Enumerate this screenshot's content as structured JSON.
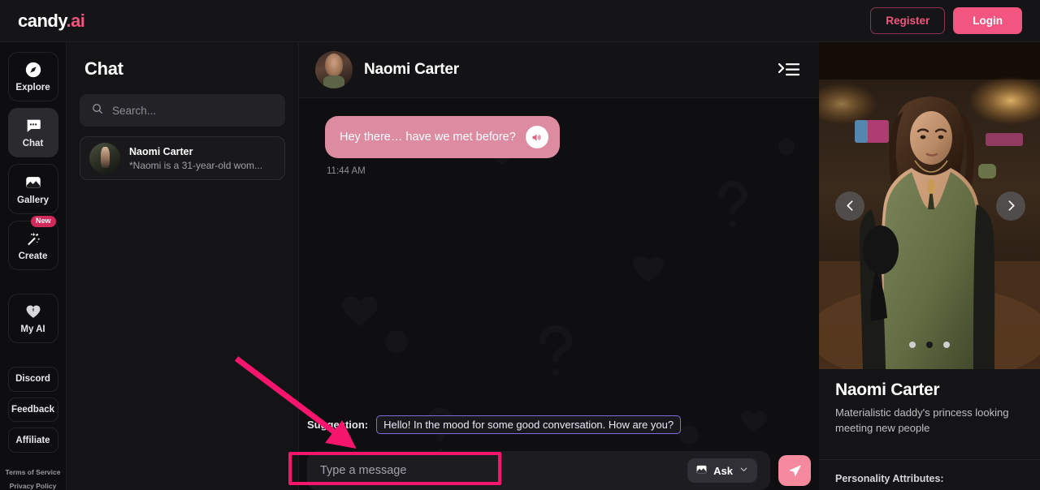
{
  "topbar": {
    "logo_main": "candy",
    "logo_accent": ".ai",
    "register_label": "Register",
    "login_label": "Login",
    "accent_color": "#f2557f"
  },
  "sidebar": {
    "items": [
      {
        "label": "Explore",
        "icon": "compass-icon",
        "active": false
      },
      {
        "label": "Chat",
        "icon": "chat-bubble-icon",
        "active": true
      },
      {
        "label": "Gallery",
        "icon": "image-icon",
        "active": false
      },
      {
        "label": "Create",
        "icon": "magic-wand-icon",
        "active": false,
        "badge": "New"
      },
      {
        "label": "My AI",
        "icon": "heart-icon",
        "active": false
      }
    ],
    "links": [
      {
        "label": "Discord"
      },
      {
        "label": "Feedback"
      },
      {
        "label": "Affiliate"
      }
    ],
    "legal": [
      {
        "label": "Terms of Service"
      },
      {
        "label": "Privacy Policy"
      }
    ]
  },
  "chatlist": {
    "title": "Chat",
    "search_placeholder": "Search...",
    "conversations": [
      {
        "name": "Naomi Carter",
        "snippet": "*Naomi is a 31-year-old wom..."
      }
    ]
  },
  "chat": {
    "header_name": "Naomi Carter",
    "messages": [
      {
        "text": "Hey there… have we met before?",
        "time": "11:44 AM",
        "from": "character"
      }
    ]
  },
  "composer": {
    "suggestion_label": "Suggestion:",
    "suggestion_text": "Hello! In the mood for some good conversation. How are you?",
    "input_placeholder": "Type a message",
    "ask_label": "Ask",
    "send_icon": "send-paper-plane-icon"
  },
  "character_panel": {
    "name": "Naomi Carter",
    "description": "Materialistic daddy's princess looking meeting new people",
    "attributes_title": "Personality Attributes:",
    "carousel": {
      "dots": 3,
      "active_index": 1,
      "prev_icon": "chevron-left-icon",
      "next_icon": "chevron-right-icon"
    }
  },
  "annotations": {
    "arrow_color": "#f5156c",
    "box_color": "#f5156c"
  }
}
